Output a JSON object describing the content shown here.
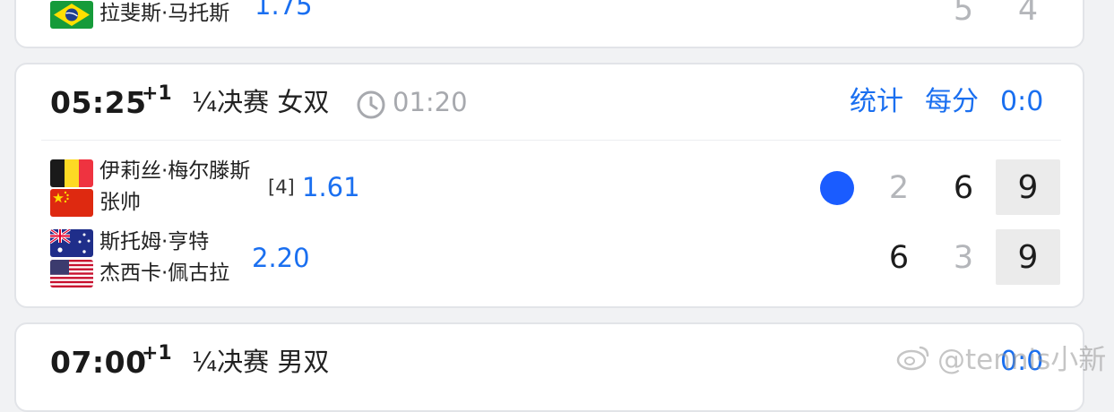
{
  "prev_match": {
    "player_name": "拉斐斯·马托斯",
    "odds": "1.75",
    "scores": [
      "5",
      "4"
    ]
  },
  "main_match": {
    "time": "05:25",
    "day_offset": "+1",
    "round": "¼决赛 女双",
    "elapsed": "01:20",
    "stats_link": "统计",
    "points_link": "每分",
    "point_score": "0:0",
    "team1": {
      "players": [
        "伊莉丝·梅尔滕斯",
        "张帅"
      ],
      "seed": "[4]",
      "odds": "1.61",
      "serving": true,
      "sets": [
        "2",
        "6"
      ],
      "game": "9"
    },
    "team2": {
      "players": [
        "斯托姆·亨特",
        "杰西卡·佩古拉"
      ],
      "odds": "2.20",
      "sets": [
        "6",
        "3"
      ],
      "game": "9"
    }
  },
  "next_match": {
    "time": "07:00",
    "day_offset": "+1",
    "round": "¼决赛 男双",
    "point_score": "0:0"
  },
  "watermark": "@tennis小新",
  "colors": {
    "accent_blue": "#1a6ff0",
    "serve_blue": "#1a5cff"
  }
}
